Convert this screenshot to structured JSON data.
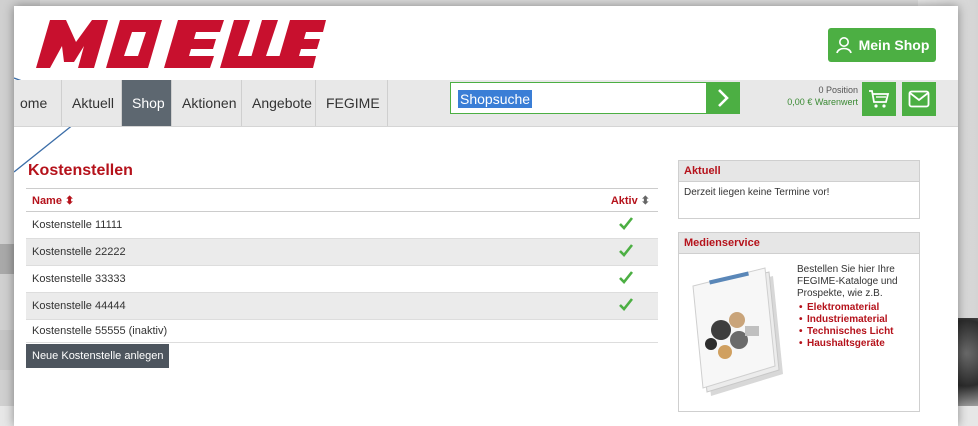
{
  "brand": {
    "logo_text": "MOELLE",
    "logo_color": "#c8102e"
  },
  "header": {
    "mein_shop_label": "Mein Shop"
  },
  "nav": {
    "items": [
      "ome",
      "Aktuell",
      "Shop",
      "Aktionen",
      "Angebote",
      "FEGIME"
    ],
    "active": "Shop"
  },
  "search": {
    "value": "Shopsuche"
  },
  "cart": {
    "positions": "0 Position",
    "value": "0,00 € Warenwert"
  },
  "main": {
    "title": "Kostenstellen",
    "table": {
      "col_name": "Name",
      "col_aktiv": "Aktiv",
      "rows": [
        {
          "name": "Kostenstelle 11111",
          "aktiv": true
        },
        {
          "name": "Kostenstelle 22222",
          "aktiv": true
        },
        {
          "name": "Kostenstelle 33333",
          "aktiv": true
        },
        {
          "name": "Kostenstelle 44444",
          "aktiv": true
        },
        {
          "name": "Kostenstelle 55555 (inaktiv)",
          "aktiv": false
        }
      ]
    },
    "new_button_label": "Neue Kostenstelle anlegen"
  },
  "sidebar": {
    "aktuell": {
      "title": "Aktuell",
      "text": "Derzeit liegen keine Termine vor!"
    },
    "medienservice": {
      "title": "Medienservice",
      "text": "Bestellen Sie hier Ihre FEGIME-Kataloge und Prospekte, wie z.B.",
      "items": [
        "Elektromaterial",
        "Industriematerial",
        "Technisches Licht",
        "Haushaltsgeräte"
      ]
    }
  },
  "colors": {
    "accent_green": "#4caf43",
    "brand_red": "#b5121b",
    "nav_active": "#5d6770"
  }
}
